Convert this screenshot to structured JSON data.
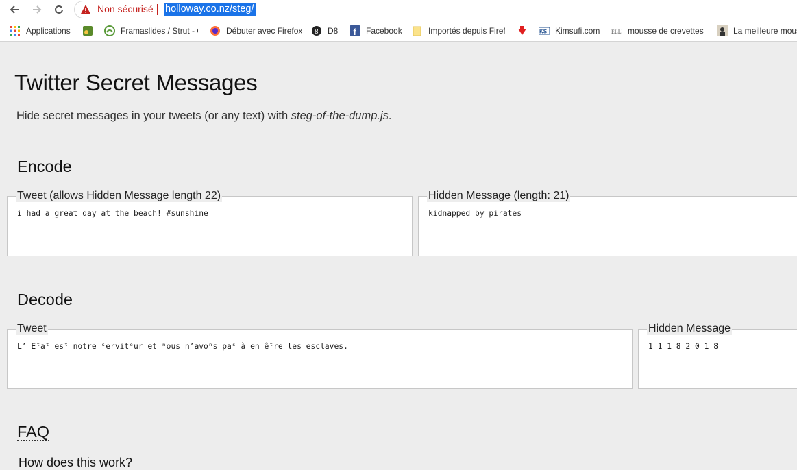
{
  "browser": {
    "security_label": "Non sécurisé",
    "url": "holloway.co.nz/steg/"
  },
  "bookmarks": [
    {
      "label": "Applications",
      "icon": "apps-grid-icon"
    },
    {
      "label": "",
      "icon": "green-square-icon"
    },
    {
      "label": "Framaslides / Strut - C",
      "icon": "framaslides-icon"
    },
    {
      "label": "Débuter avec Firefox",
      "icon": "firefox-icon"
    },
    {
      "label": "D8",
      "icon": "d8-icon"
    },
    {
      "label": "Facebook",
      "icon": "facebook-icon"
    },
    {
      "label": "Importés depuis Firef",
      "icon": "folder-icon"
    },
    {
      "label": "",
      "icon": "red-arrow-icon"
    },
    {
      "label": "Kimsufi.com",
      "icon": "kimsufi-icon"
    },
    {
      "label": "mousse de crevettes",
      "icon": "recipe-icon"
    },
    {
      "label": "La meilleure mous",
      "icon": "photo-icon"
    }
  ],
  "page": {
    "title": "Twitter Secret Messages",
    "intro_text": "Hide secret messages in your tweets (or any text) with ",
    "intro_lib": "steg-of-the-dump.js",
    "intro_end": ".",
    "encode": {
      "heading": "Encode",
      "tweet_label": "Tweet (allows Hidden Message length 22)",
      "tweet_value": "i had a great day at the beach! #sunshine",
      "hidden_label": "Hidden Message (length: 21)",
      "hidden_value": "kidnapped by pirates"
    },
    "decode": {
      "heading": "Decode",
      "tweet_label": "Tweet",
      "tweet_value": "L’ Eᵗaᵗ esᵗ notre ˢervitᵉur et ⁿous n’avoⁿs paˢ à en êᵗre les esclaves.",
      "hidden_label": "Hidden Message",
      "hidden_value": "1 1 1 8 2 0 1 8"
    },
    "faq_heading": "FAQ",
    "faq_question": "How does this work?"
  }
}
